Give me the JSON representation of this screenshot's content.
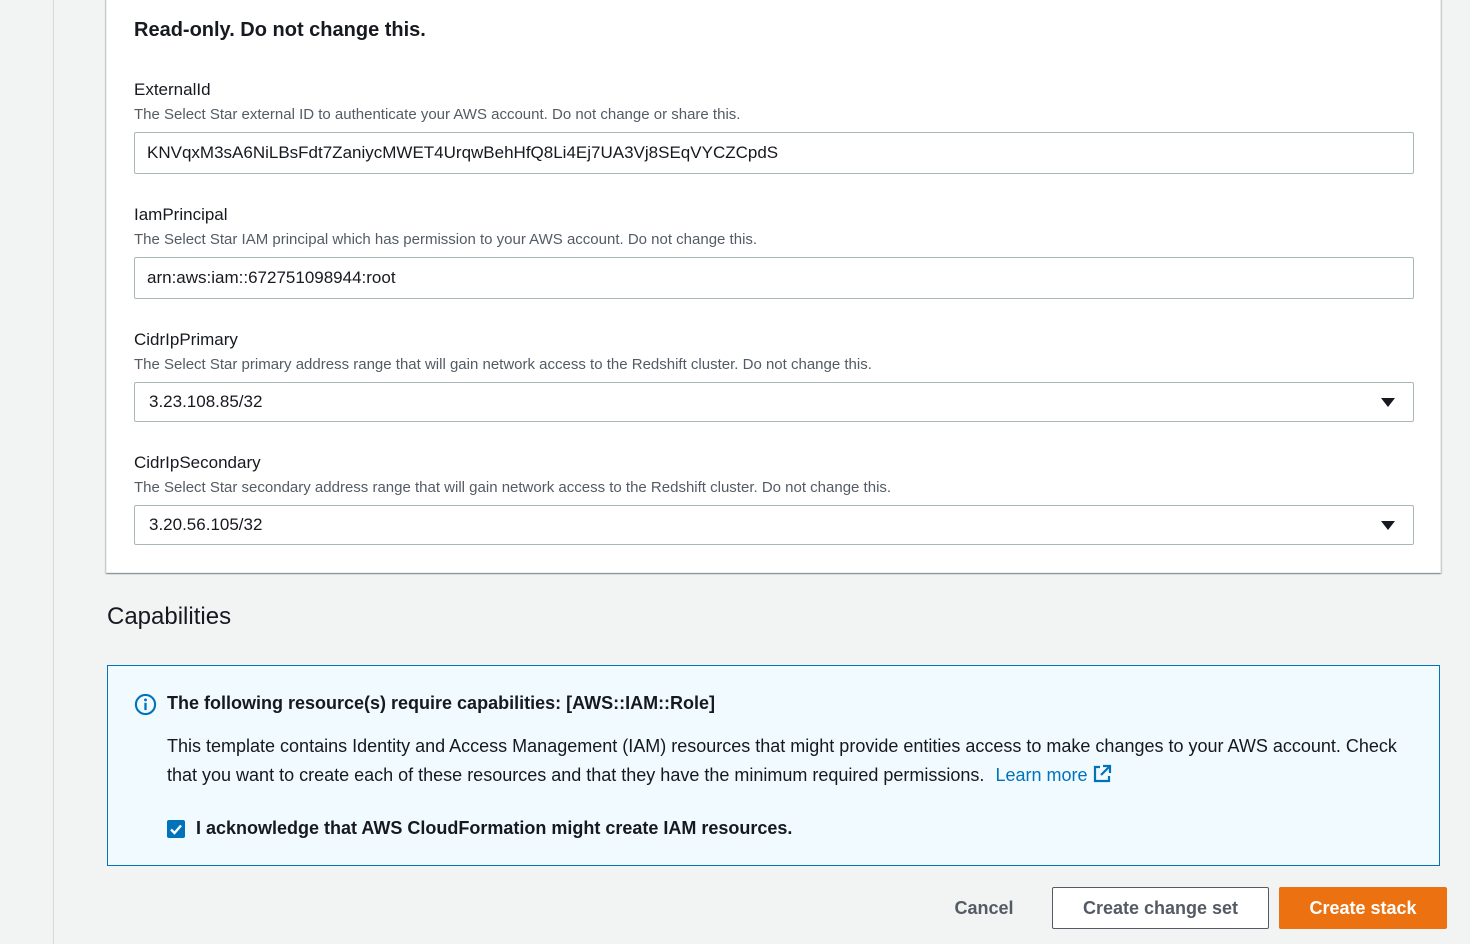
{
  "params": {
    "group_heading": "Read-only. Do not change this.",
    "external_id": {
      "label": "ExternalId",
      "description": "The Select Star external ID to authenticate your AWS account. Do not change or share this.",
      "value": "KNVqxM3sA6NiLBsFdt7ZaniycMWET4UrqwBehHfQ8Li4Ej7UA3Vj8SEqVYCZCpdS"
    },
    "iam_principal": {
      "label": "IamPrincipal",
      "description": "The Select Star IAM principal which has permission to your AWS account. Do not change this.",
      "value": "arn:aws:iam::672751098944:root"
    },
    "cidr_primary": {
      "label": "CidrIpPrimary",
      "description": "The Select Star primary address range that will gain network access to the Redshift cluster. Do not change this.",
      "value": "3.23.108.85/32"
    },
    "cidr_secondary": {
      "label": "CidrIpSecondary",
      "description": "The Select Star secondary address range that will gain network access to the Redshift cluster. Do not change this.",
      "value": "3.20.56.105/32"
    }
  },
  "capabilities": {
    "title": "Capabilities",
    "alert_title": "The following resource(s) require capabilities: [AWS::IAM::Role]",
    "alert_body": "This template contains Identity and Access Management (IAM) resources that might provide entities access to make changes to your AWS account. Check that you want to create each of these resources and that they have the minimum required permissions.",
    "learn_more": "Learn more",
    "acknowledge_label": "I acknowledge that AWS CloudFormation might create IAM resources.",
    "acknowledged": true
  },
  "actions": {
    "cancel": "Cancel",
    "create_change_set": "Create change set",
    "create_stack": "Create stack"
  },
  "colors": {
    "primary_button": "#ec7211",
    "link": "#0073bb",
    "info_background": "#f1faff",
    "info_border": "#0073bb"
  },
  "icons": {
    "info": "info-circle-icon",
    "external_link": "external-link-icon",
    "dropdown": "caret-down-icon",
    "checkbox": "checkmark-icon"
  }
}
